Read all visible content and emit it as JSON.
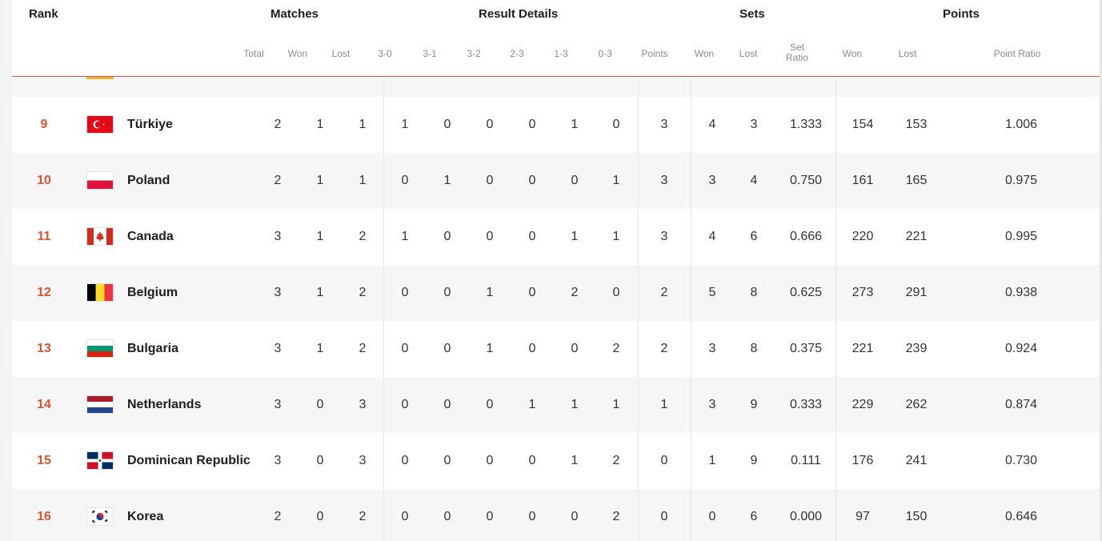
{
  "header": {
    "rank": "Rank",
    "groups": {
      "matches": "Matches",
      "result_details": "Result Details",
      "sets": "Sets",
      "points": "Points"
    },
    "sub": {
      "total": "Total",
      "m_won": "Won",
      "m_lost": "Lost",
      "r30": "3-0",
      "r31": "3-1",
      "r32": "3-2",
      "r23": "2-3",
      "r13": "1-3",
      "r03": "0-3",
      "pts": "Points",
      "s_won": "Won",
      "s_lost": "Lost",
      "set_ratio_1": "Set",
      "set_ratio_2": "Ratio",
      "p_won": "Won",
      "p_lost": "Lost",
      "point_ratio": "Point Ratio"
    }
  },
  "colors": {
    "accent": "#e0532f",
    "header_line": "#e2523f"
  },
  "rows": [
    {
      "rank": "9",
      "flag": "flag-turkiye",
      "team": "Türkiye",
      "total": "2",
      "won": "1",
      "lost": "1",
      "r30": "1",
      "r31": "0",
      "r32": "0",
      "r23": "0",
      "r13": "1",
      "r03": "0",
      "pts": "3",
      "s_won": "4",
      "s_lost": "3",
      "set_ratio": "1.333",
      "p_won": "154",
      "p_lost": "153",
      "point_ratio": "1.006"
    },
    {
      "rank": "10",
      "flag": "flag-poland",
      "team": "Poland",
      "total": "2",
      "won": "1",
      "lost": "1",
      "r30": "0",
      "r31": "1",
      "r32": "0",
      "r23": "0",
      "r13": "0",
      "r03": "1",
      "pts": "3",
      "s_won": "3",
      "s_lost": "4",
      "set_ratio": "0.750",
      "p_won": "161",
      "p_lost": "165",
      "point_ratio": "0.975"
    },
    {
      "rank": "11",
      "flag": "flag-canada",
      "team": "Canada",
      "total": "3",
      "won": "1",
      "lost": "2",
      "r30": "1",
      "r31": "0",
      "r32": "0",
      "r23": "0",
      "r13": "1",
      "r03": "1",
      "pts": "3",
      "s_won": "4",
      "s_lost": "6",
      "set_ratio": "0.666",
      "p_won": "220",
      "p_lost": "221",
      "point_ratio": "0.995"
    },
    {
      "rank": "12",
      "flag": "flag-belgium",
      "team": "Belgium",
      "total": "3",
      "won": "1",
      "lost": "2",
      "r30": "0",
      "r31": "0",
      "r32": "1",
      "r23": "0",
      "r13": "2",
      "r03": "0",
      "pts": "2",
      "s_won": "5",
      "s_lost": "8",
      "set_ratio": "0.625",
      "p_won": "273",
      "p_lost": "291",
      "point_ratio": "0.938"
    },
    {
      "rank": "13",
      "flag": "flag-bulgaria",
      "team": "Bulgaria",
      "total": "3",
      "won": "1",
      "lost": "2",
      "r30": "0",
      "r31": "0",
      "r32": "1",
      "r23": "0",
      "r13": "0",
      "r03": "2",
      "pts": "2",
      "s_won": "3",
      "s_lost": "8",
      "set_ratio": "0.375",
      "p_won": "221",
      "p_lost": "239",
      "point_ratio": "0.924"
    },
    {
      "rank": "14",
      "flag": "flag-netherlands",
      "team": "Netherlands",
      "total": "3",
      "won": "0",
      "lost": "3",
      "r30": "0",
      "r31": "0",
      "r32": "0",
      "r23": "1",
      "r13": "1",
      "r03": "1",
      "pts": "1",
      "s_won": "3",
      "s_lost": "9",
      "set_ratio": "0.333",
      "p_won": "229",
      "p_lost": "262",
      "point_ratio": "0.874"
    },
    {
      "rank": "15",
      "flag": "flag-dominican-republic",
      "team": "Dominican Republic",
      "total": "3",
      "won": "0",
      "lost": "3",
      "r30": "0",
      "r31": "0",
      "r32": "0",
      "r23": "0",
      "r13": "1",
      "r03": "2",
      "pts": "0",
      "s_won": "1",
      "s_lost": "9",
      "set_ratio": "0.111",
      "p_won": "176",
      "p_lost": "241",
      "point_ratio": "0.730"
    },
    {
      "rank": "16",
      "flag": "flag-korea",
      "team": "Korea",
      "total": "2",
      "won": "0",
      "lost": "2",
      "r30": "0",
      "r31": "0",
      "r32": "0",
      "r23": "0",
      "r13": "0",
      "r03": "2",
      "pts": "0",
      "s_won": "0",
      "s_lost": "6",
      "set_ratio": "0.000",
      "p_won": "97",
      "p_lost": "150",
      "point_ratio": "0.646"
    }
  ]
}
